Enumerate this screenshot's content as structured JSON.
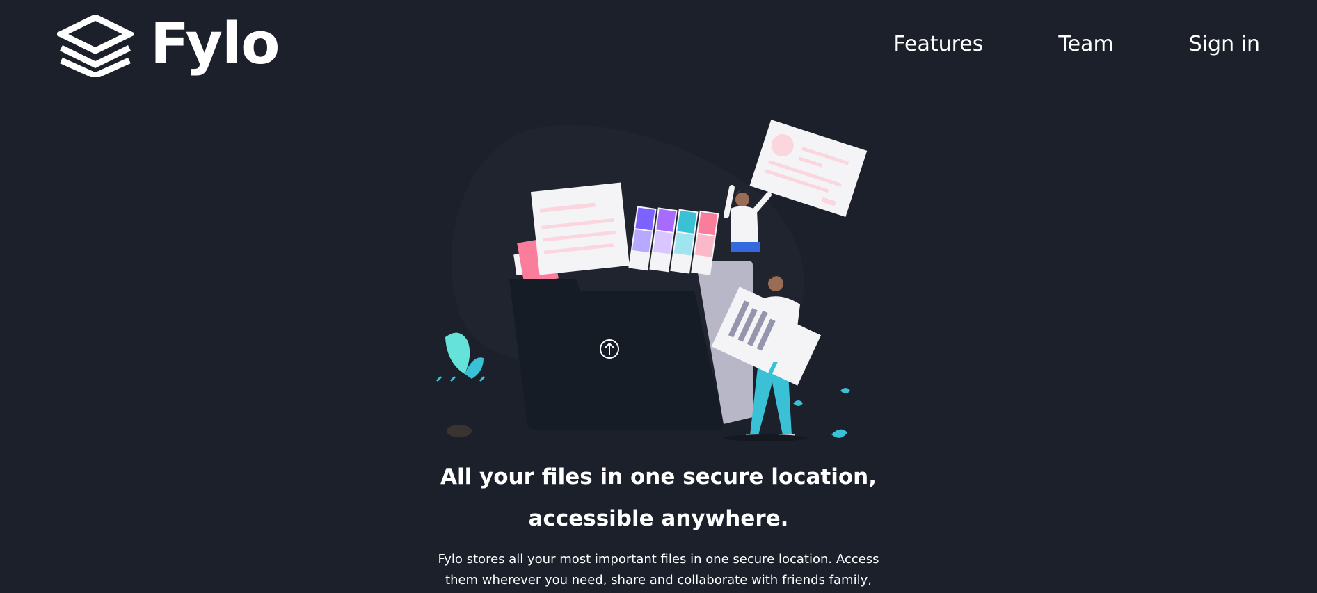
{
  "header": {
    "logo_text": "Fylo",
    "nav": [
      {
        "label": "Features"
      },
      {
        "label": "Team"
      },
      {
        "label": "Sign in"
      }
    ]
  },
  "hero": {
    "title_line1": "All your files in one secure location,",
    "title_line2": "accessible anywhere.",
    "text_line1": "Fylo stores all your most important files in one secure location. Access",
    "text_line2": "them wherever you need, share and collaborate with friends family,"
  },
  "colors": {
    "background": "#1b202b",
    "accent_cyan": "#65e2d9",
    "accent_pink": "#fa7d9b",
    "accent_purple": "#7c63ff"
  },
  "icons": {
    "logo": "stacked-layers-icon",
    "upload": "upload-arrow-icon"
  }
}
